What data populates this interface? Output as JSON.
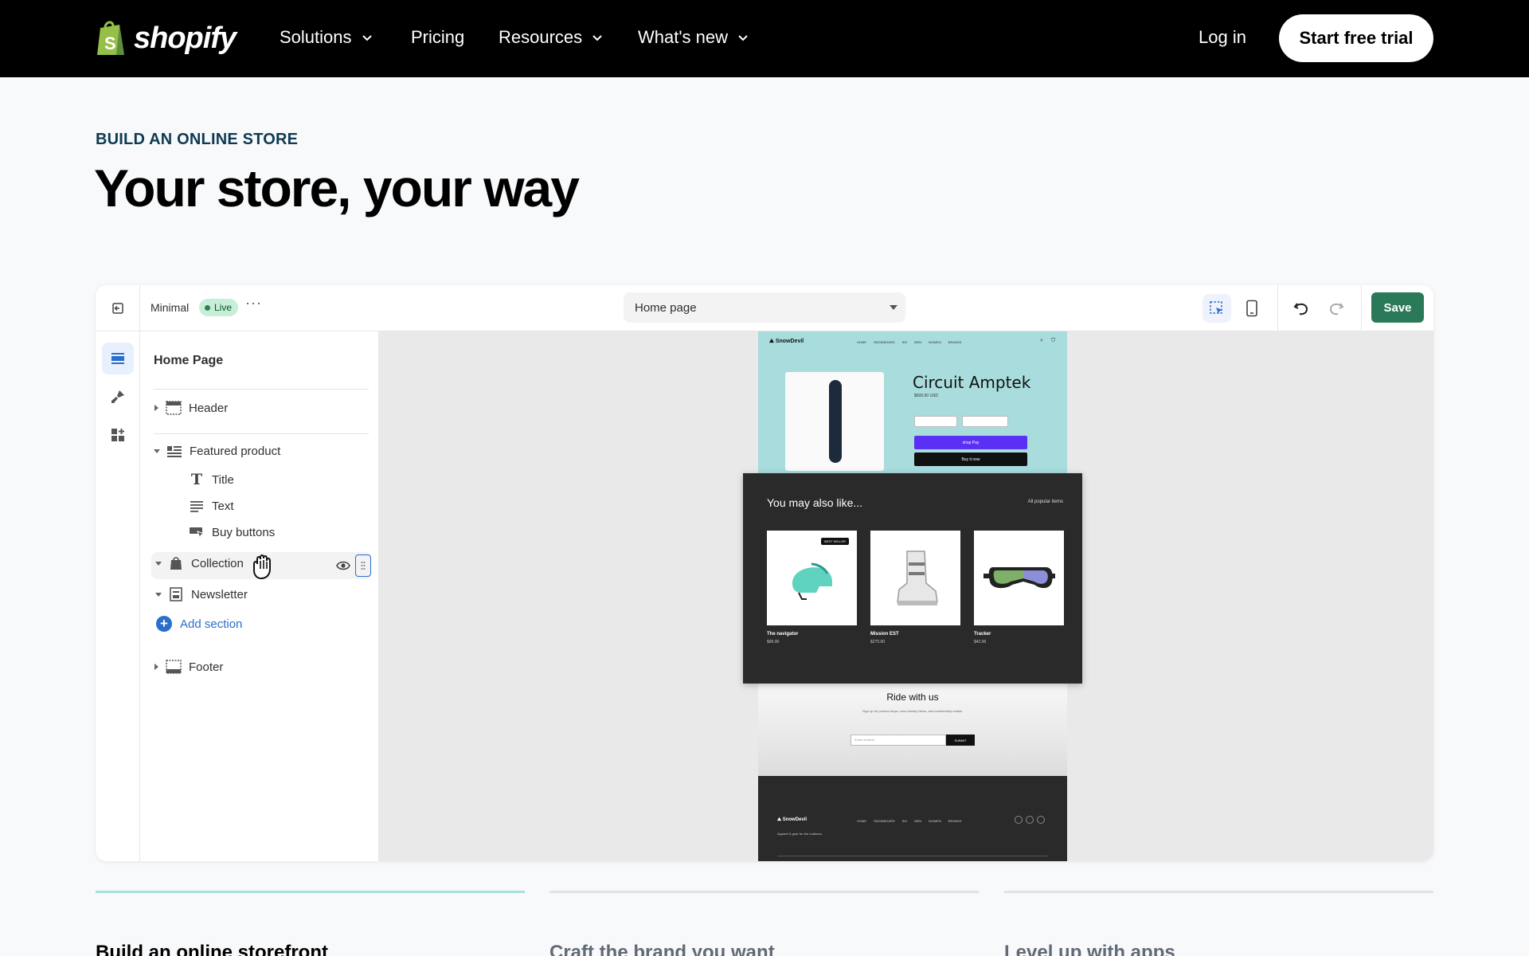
{
  "nav": {
    "brand": "shopify",
    "items": [
      {
        "label": "Solutions",
        "has_dropdown": true
      },
      {
        "label": "Pricing",
        "has_dropdown": false
      },
      {
        "label": "Resources",
        "has_dropdown": true
      },
      {
        "label": "What's new",
        "has_dropdown": true
      }
    ],
    "login": "Log in",
    "cta": "Start free trial"
  },
  "hero": {
    "eyebrow": "BUILD AN ONLINE STORE",
    "title": "Your store, your way"
  },
  "editor": {
    "theme_name": "Minimal",
    "live_badge": "Live",
    "more": "···",
    "page_select": "Home page",
    "save": "Save",
    "sidebar": {
      "title": "Home Page",
      "sections": {
        "header": "Header",
        "featured_product": "Featured product",
        "title_block": "Title",
        "text_block": "Text",
        "buy_buttons_block": "Buy buttons",
        "collection": "Collection",
        "newsletter": "Newsletter",
        "add_section": "Add section",
        "footer": "Footer"
      }
    },
    "preview": {
      "store_name": "SnowDevil",
      "nav_links": [
        "HOME",
        "SNOWBOARD",
        "SKI",
        "MEN",
        "WOMEN",
        "BRANDS"
      ],
      "product_title": "Circuit Amptek",
      "product_price": "$600.00 USD",
      "shop_pay": "shop Pay",
      "buy_now": "Buy it now",
      "also_like_title": "You may also like...",
      "also_like_link": "All popular items",
      "best_seller": "BEST SELLER",
      "products": [
        {
          "name": "The navigator",
          "price": "$99.00"
        },
        {
          "name": "Mission EST",
          "price": "$275.00"
        },
        {
          "name": "Tracker",
          "price": "$42.00"
        }
      ],
      "newsletter_title": "Ride with us",
      "newsletter_sub": "Sign up for product drops, new industry items, and membership emails.",
      "email_placeholder": "Email address",
      "submit": "SUBMIT",
      "footer_tagline": "Apparel & gear for the outdoors"
    }
  },
  "tabs": [
    {
      "label": "Build an online storefront",
      "active": true
    },
    {
      "label": "Craft the brand you want",
      "active": false
    },
    {
      "label": "Level up with apps",
      "active": false
    }
  ],
  "colors": {
    "nav_bg": "#000000",
    "eyebrow": "#0e3a52",
    "save_btn": "#2a7a5a",
    "live_badge": "#c7eed6",
    "accent_blue": "#2c6ecb",
    "active_tab": "#a6e1d9"
  }
}
